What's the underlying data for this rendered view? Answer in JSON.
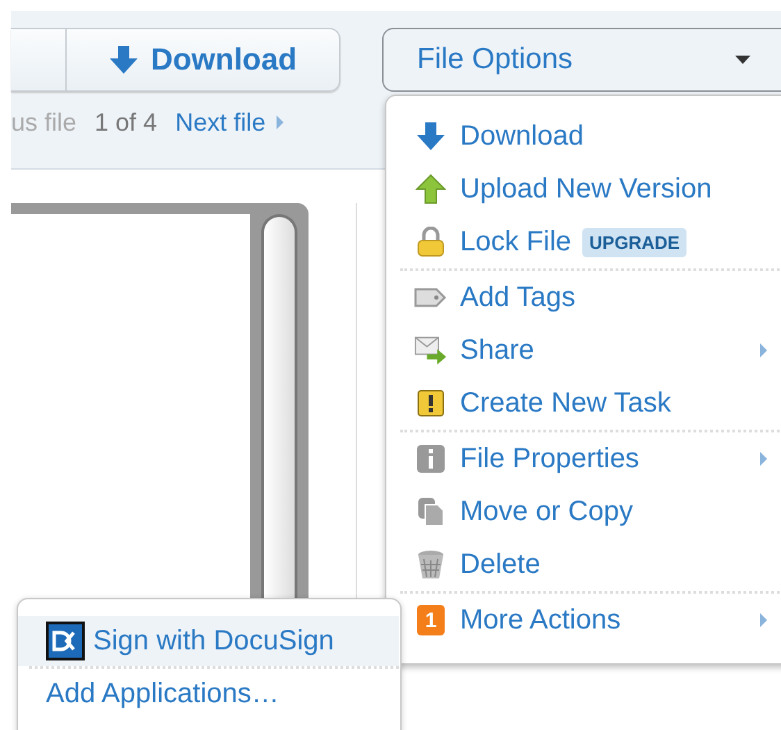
{
  "toolbar": {
    "download_button": {
      "label": "Download"
    },
    "file_options": {
      "label": "File Options",
      "expanded": true
    }
  },
  "pager": {
    "previous": "us file",
    "position": "1 of 4",
    "next": "Next file"
  },
  "file_menu": {
    "groups": [
      [
        {
          "label": "Download",
          "has_submenu": false
        },
        {
          "label": "Upload New Version",
          "has_submenu": false
        },
        {
          "label": "Lock File",
          "badge": "UPGRADE",
          "has_submenu": false
        }
      ],
      [
        {
          "label": "Add Tags",
          "has_submenu": false
        },
        {
          "label": "Share",
          "has_submenu": true
        },
        {
          "label": "Create New Task",
          "has_submenu": false
        }
      ],
      [
        {
          "label": "File Properties",
          "has_submenu": true
        },
        {
          "label": "Move or Copy",
          "has_submenu": false
        },
        {
          "label": "Delete",
          "has_submenu": false
        }
      ],
      [
        {
          "label": "More Actions",
          "badge": "1",
          "has_submenu": true
        }
      ]
    ]
  },
  "more_actions_menu": {
    "items": [
      {
        "label": "Sign with DocuSign",
        "selected": true
      },
      {
        "label": "Add Applications…",
        "selected": false
      }
    ]
  }
}
